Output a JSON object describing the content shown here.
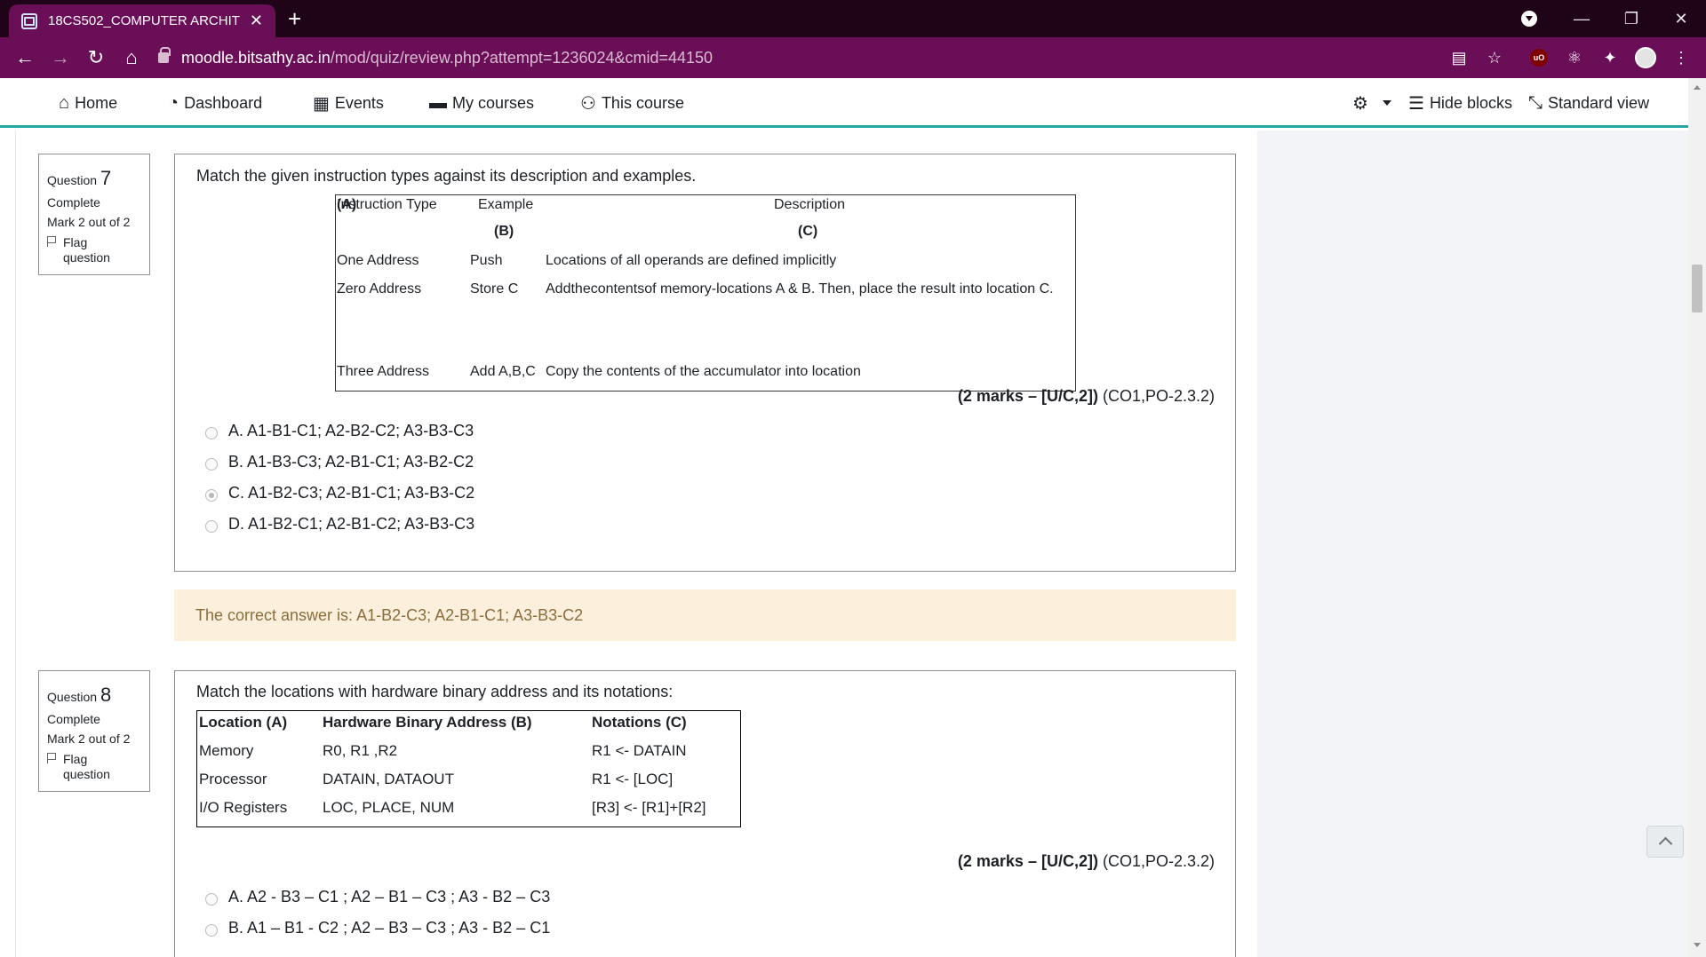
{
  "browser": {
    "tab_title": "18CS502_COMPUTER ARCHITECT",
    "tab_close": "✕",
    "new_tab": "+",
    "url_host": "moodle.bitsathy.ac.in",
    "url_path": "/mod/quiz/review.php?attempt=1236024&cmid=44150",
    "ublock_label": "uO"
  },
  "nav": {
    "home": "Home",
    "dashboard": "Dashboard",
    "events": "Events",
    "my_courses": "My courses",
    "this_course": "This course",
    "hide_blocks": "Hide blocks",
    "standard_view": "Standard view"
  },
  "q7": {
    "label": "Question",
    "number": "7",
    "state": "Complete",
    "mark": "Mark 2 out of 2",
    "flag1": "Flag",
    "flag2": "question",
    "prompt": "Match the given instruction types against its description and examples.",
    "table": {
      "h1": "Instruction Type ",
      "h1b": "(A)",
      "h2": "Example",
      "h2b": "(B)",
      "h3": "Description",
      "h3b": "(C)",
      "r1c1": "One Address",
      "r1c2": "Push",
      "r1c3": "Locations of all operands are defined implicitly",
      "r2c1": "Zero Address",
      "r2c2": "Store C",
      "r2c3": "Addthecontentsof memory-locations A & B. Then, place the result into location C.",
      "r3c1": "Three Address",
      "r3c2": "Add A,B,C",
      "r3c3": "Copy the contents of the accumulator into location"
    },
    "marks_bold": "(2 marks – [U/C,2])",
    "marks_rest": " (CO1,PO-2.3.2)",
    "options": [
      "A. A1-B1-C1; A2-B2-C2; A3-B3-C3",
      "B. A1-B3-C3; A2-B1-C1; A3-B2-C2",
      "C. A1-B2-C3; A2-B1-C1; A3-B3-C2",
      "D. A1-B2-C1; A2-B1-C2; A3-B3-C3"
    ],
    "selected_option": 2,
    "feedback": "The correct answer is: A1-B2-C3; A2-B1-C1; A3-B3-C2"
  },
  "q8": {
    "label": "Question",
    "number": "8",
    "state": "Complete",
    "mark": "Mark 2 out of 2",
    "flag1": "Flag",
    "flag2": "question",
    "prompt": "Match the locations with hardware binary address and its notations:",
    "table": {
      "h1": "Location (A)",
      "h2": "Hardware Binary Address (B)",
      "h3": "Notations (C)",
      "r1c1": "Memory",
      "r1c2": "R0, R1 ,R2",
      "r1c3": "R1 <- DATAIN",
      "r2c1": "Processor",
      "r2c2": "DATAIN, DATAOUT",
      "r2c3": "R1 <- [LOC]",
      "r3c1": "I/O Registers",
      "r3c2": "LOC, PLACE, NUM",
      "r3c3": "[R3] <- [R1]+[R2]"
    },
    "marks_bold": "(2 marks – [U/C,2])",
    "marks_rest": " (CO1,PO-2.3.2)",
    "options": [
      "A. A2 - B3 – C1 ; A2 – B1 – C3 ; A3 - B2 – C3",
      "B. A1 – B1 - C2 ; A2 – B3 – C3 ; A3 - B2 – C1"
    ]
  },
  "colors": {
    "accent": "#6a0e57",
    "nav_underline": "#23a7a0",
    "feedback_bg": "#fcefdc",
    "feedback_text": "#8a6d3b"
  }
}
